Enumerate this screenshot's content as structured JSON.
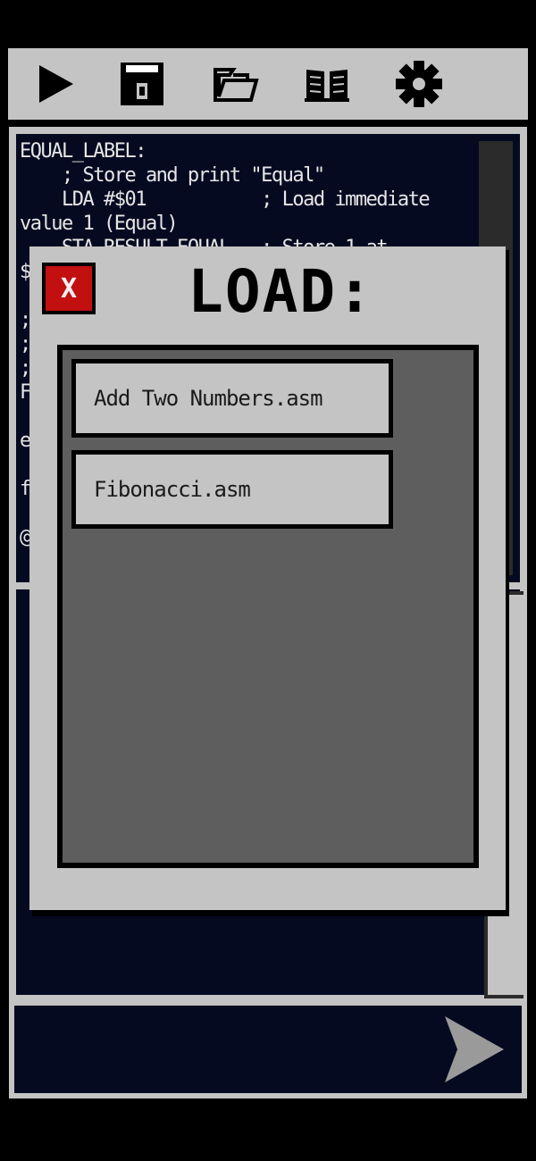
{
  "toolbar": {
    "icons": [
      "play-icon",
      "save-icon",
      "folder-open-icon",
      "book-icon",
      "gear-icon"
    ]
  },
  "editor": {
    "code_lines": [
      "EQUAL_LABEL:",
      "    ; Store and print \"Equal\"",
      "    LDA #$01           ; Load immediate",
      "value 1 (Equal)",
      "    STA RESULT_EQUAL   ; Store 1 at",
      "$",
      "",
      ";",
      ";",
      ";",
      "F",
      "",
      "e",
      "",
      "f",
      "",
      "@"
    ]
  },
  "modal": {
    "title": "LOAD:",
    "close_label": "X",
    "files": [
      "Add Two Numbers.asm",
      "Fibonacci.asm"
    ]
  },
  "colors": {
    "panel": "#c4c4c4",
    "editor_bg": "#060a20",
    "list_bg": "#5e5e5e",
    "close_red": "#c21010"
  }
}
